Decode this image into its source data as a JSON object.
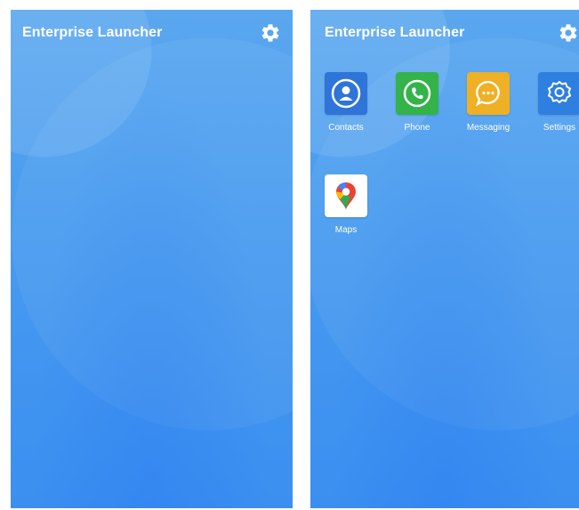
{
  "screens": [
    {
      "title": "Enterprise Launcher",
      "settings_icon": "gear-icon",
      "apps": []
    },
    {
      "title": "Enterprise Launcher",
      "settings_icon": "gear-icon",
      "apps": [
        {
          "label": "Contacts",
          "icon": "contacts-icon",
          "color": "#2f74d9"
        },
        {
          "label": "Phone",
          "icon": "phone-icon",
          "color": "#33b34a"
        },
        {
          "label": "Messaging",
          "icon": "messaging-icon",
          "color": "#efb026"
        },
        {
          "label": "Settings",
          "icon": "settings-icon",
          "color": "#2f7fe0"
        },
        {
          "label": "Maps",
          "icon": "maps-pin-icon",
          "color": "#ffffff"
        }
      ]
    }
  ],
  "colors": {
    "background_top": "#5aa7ef",
    "background_bottom": "#3a8ff0",
    "text": "#ffffff"
  }
}
